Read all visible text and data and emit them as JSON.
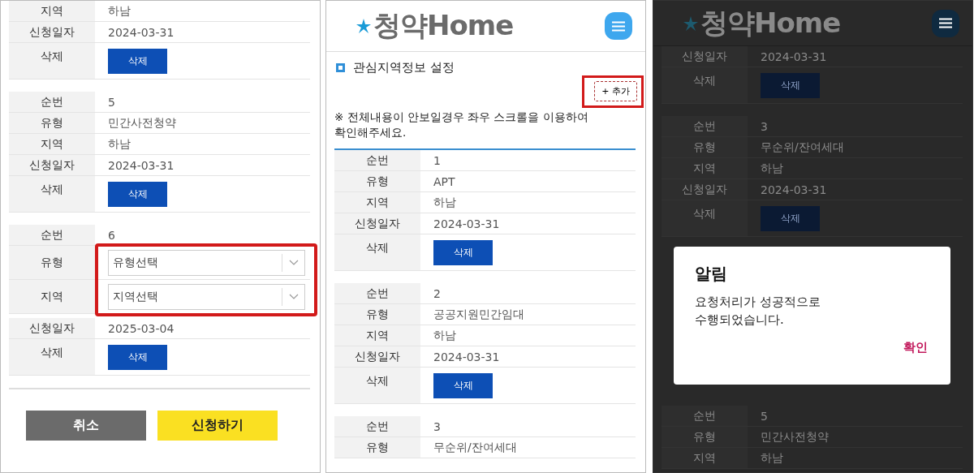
{
  "screens": [
    {
      "dimmed": false,
      "blocks": [
        {
          "rows": [
            {
              "kind": "text",
              "label": "지역",
              "value": "하남"
            },
            {
              "kind": "text",
              "label": "신청일자",
              "value": "2024-03-31"
            },
            {
              "kind": "button",
              "label": "삭제",
              "button": "삭제"
            }
          ]
        },
        {
          "rows": [
            {
              "kind": "text",
              "label": "순번",
              "value": "5"
            },
            {
              "kind": "text",
              "label": "유형",
              "value": "민간사전청약"
            },
            {
              "kind": "text",
              "label": "지역",
              "value": "하남"
            },
            {
              "kind": "text",
              "label": "신청일자",
              "value": "2024-03-31"
            },
            {
              "kind": "button",
              "label": "삭제",
              "button": "삭제"
            }
          ]
        },
        {
          "rows": [
            {
              "kind": "text",
              "label": "순번",
              "value": "6"
            },
            {
              "kind": "group",
              "highlighted": true,
              "rows": [
                {
                  "kind": "select",
                  "label": "유형",
                  "placeholder": "유형선택"
                },
                {
                  "kind": "select",
                  "label": "지역",
                  "placeholder": "지역선택"
                }
              ]
            },
            {
              "kind": "text",
              "label": "신청일자",
              "value": "2025-03-04"
            },
            {
              "kind": "button",
              "label": "삭제",
              "button": "삭제"
            }
          ]
        }
      ],
      "actions": [
        {
          "kind": "cancel",
          "label": "취소"
        },
        {
          "kind": "submit",
          "label": "신청하기"
        }
      ]
    },
    {
      "dimmed": false,
      "logo": "청약Home",
      "section_title": "관심지역정보 설정",
      "add_button": {
        "label": "+ 추가",
        "highlighted": true
      },
      "note": "※ 전체내용이 안보일경우 좌우 스크롤을 이용하여 확인해주세요.",
      "blocks": [
        {
          "rows": [
            {
              "kind": "text",
              "label": "순번",
              "value": "1"
            },
            {
              "kind": "text",
              "label": "유형",
              "value": "APT"
            },
            {
              "kind": "text",
              "label": "지역",
              "value": "하남"
            },
            {
              "kind": "text",
              "label": "신청일자",
              "value": "2024-03-31"
            },
            {
              "kind": "button",
              "label": "삭제",
              "button": "삭제"
            }
          ]
        },
        {
          "rows": [
            {
              "kind": "text",
              "label": "순번",
              "value": "2"
            },
            {
              "kind": "text",
              "label": "유형",
              "value": "공공지원민간임대"
            },
            {
              "kind": "text",
              "label": "지역",
              "value": "하남"
            },
            {
              "kind": "text",
              "label": "신청일자",
              "value": "2024-03-31"
            },
            {
              "kind": "button",
              "label": "삭제",
              "button": "삭제"
            }
          ]
        },
        {
          "rows": [
            {
              "kind": "text",
              "label": "순번",
              "value": "3"
            },
            {
              "kind": "text",
              "label": "유형",
              "value": "무순위/잔여세대"
            }
          ]
        }
      ]
    },
    {
      "dimmed": true,
      "logo": "청약Home",
      "blocks": [
        {
          "rows": [
            {
              "kind": "text",
              "label": "신청일자",
              "value": "2024-03-31"
            },
            {
              "kind": "button",
              "label": "삭제",
              "button": "삭제"
            }
          ]
        },
        {
          "rows": [
            {
              "kind": "text",
              "label": "순번",
              "value": "3"
            },
            {
              "kind": "text",
              "label": "유형",
              "value": "무순위/잔여세대"
            },
            {
              "kind": "text",
              "label": "지역",
              "value": "하남"
            },
            {
              "kind": "text",
              "label": "신청일자",
              "value": "2024-03-31"
            },
            {
              "kind": "button",
              "label": "삭제",
              "button": "삭제"
            }
          ]
        },
        {
          "kind": "dialog",
          "title": "알림",
          "message": "요청처리가 성공적으로\n수행되었습니다.",
          "confirm": "확인"
        },
        {
          "rows": [
            {
              "kind": "text",
              "label": "순번",
              "value": "5"
            },
            {
              "kind": "text",
              "label": "유형",
              "value": "민간사전청약"
            },
            {
              "kind": "text",
              "label": "지역",
              "value": "하남"
            }
          ]
        }
      ]
    }
  ]
}
